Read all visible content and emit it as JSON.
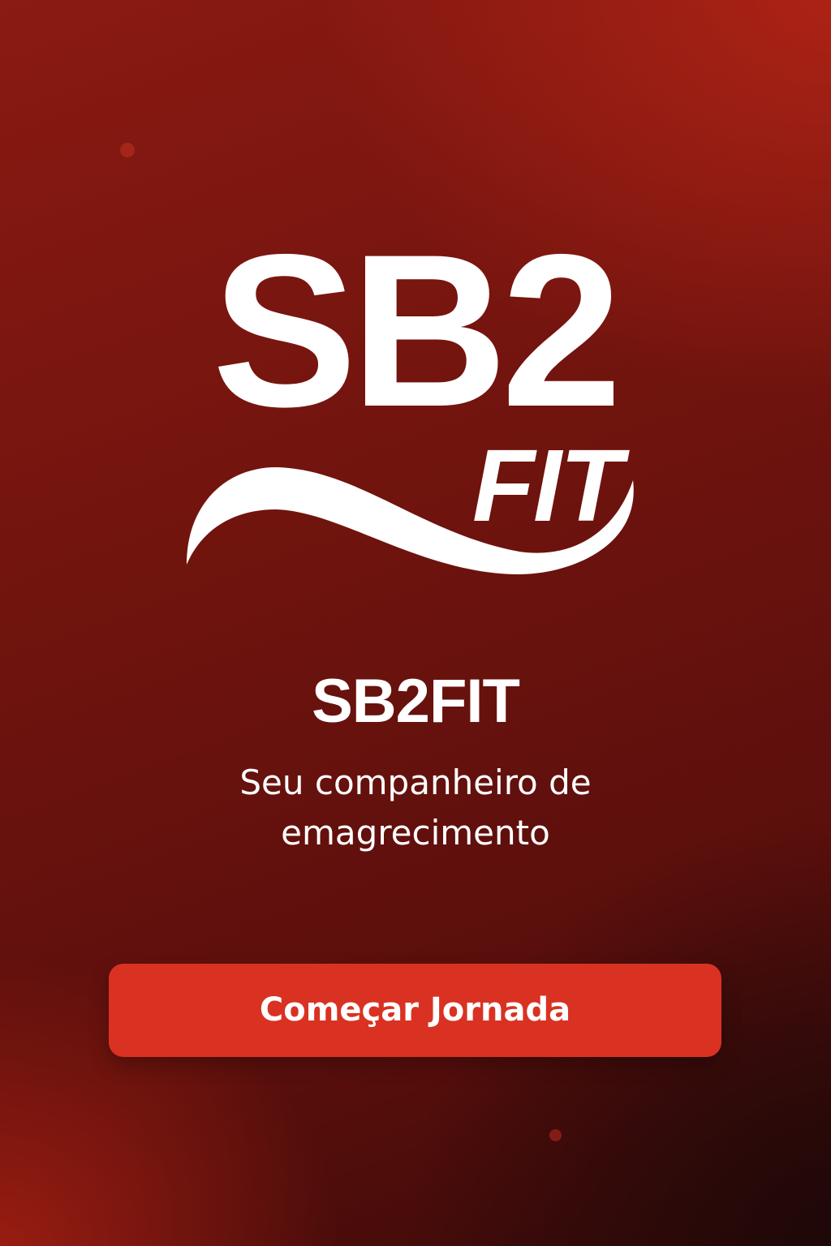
{
  "logo": {
    "top_text": "SB2",
    "bottom_text": "FIT",
    "color": "#ffffff"
  },
  "app_name": "SB2FIT",
  "tagline": {
    "line1": "Seu companheiro de",
    "line2": "emagrecimento"
  },
  "cta": {
    "label": "Começar Jornada",
    "color": "#d93222"
  },
  "theme": {
    "background_primary": "#7a1610",
    "background_dark": "#2a0808",
    "text_color": "#ffffff"
  }
}
